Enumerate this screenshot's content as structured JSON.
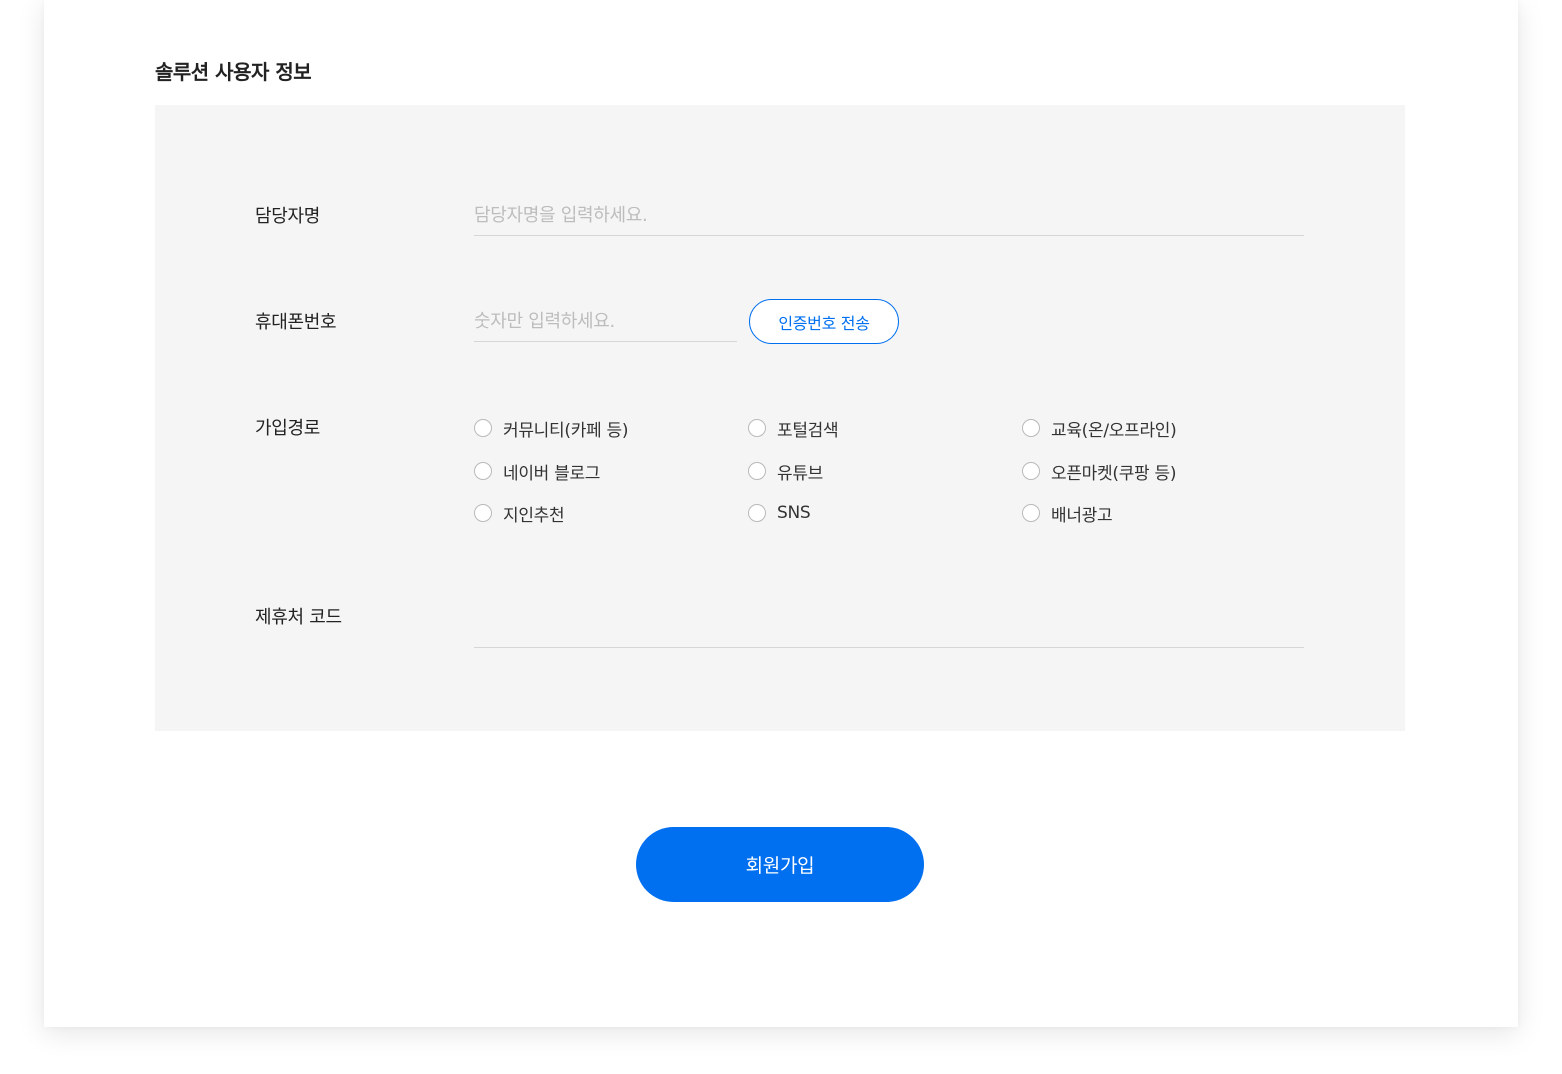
{
  "section": {
    "title": "솔루션 사용자 정보"
  },
  "form": {
    "manager_name": {
      "label": "담당자명",
      "placeholder": "담당자명을 입력하세요.",
      "value": ""
    },
    "phone": {
      "label": "휴대폰번호",
      "placeholder": "숫자만 입력하세요.",
      "value": "",
      "verify_button_label": "인증번호 전송"
    },
    "signup_path": {
      "label": "가입경로",
      "options": [
        "커뮤니티(카페 등)",
        "포털검색",
        "교육(온/오프라인)",
        "네이버 블로그",
        "유튜브",
        "오픈마켓(쿠팡 등)",
        "지인추천",
        "SNS",
        "배너광고"
      ]
    },
    "partner_code": {
      "label": "제휴처 코드",
      "placeholder": "",
      "value": ""
    }
  },
  "submit": {
    "label": "회원가입"
  },
  "colors": {
    "accent": "#0070f0",
    "panel_background": "#f5f5f5",
    "page_background": "#ffffff"
  }
}
